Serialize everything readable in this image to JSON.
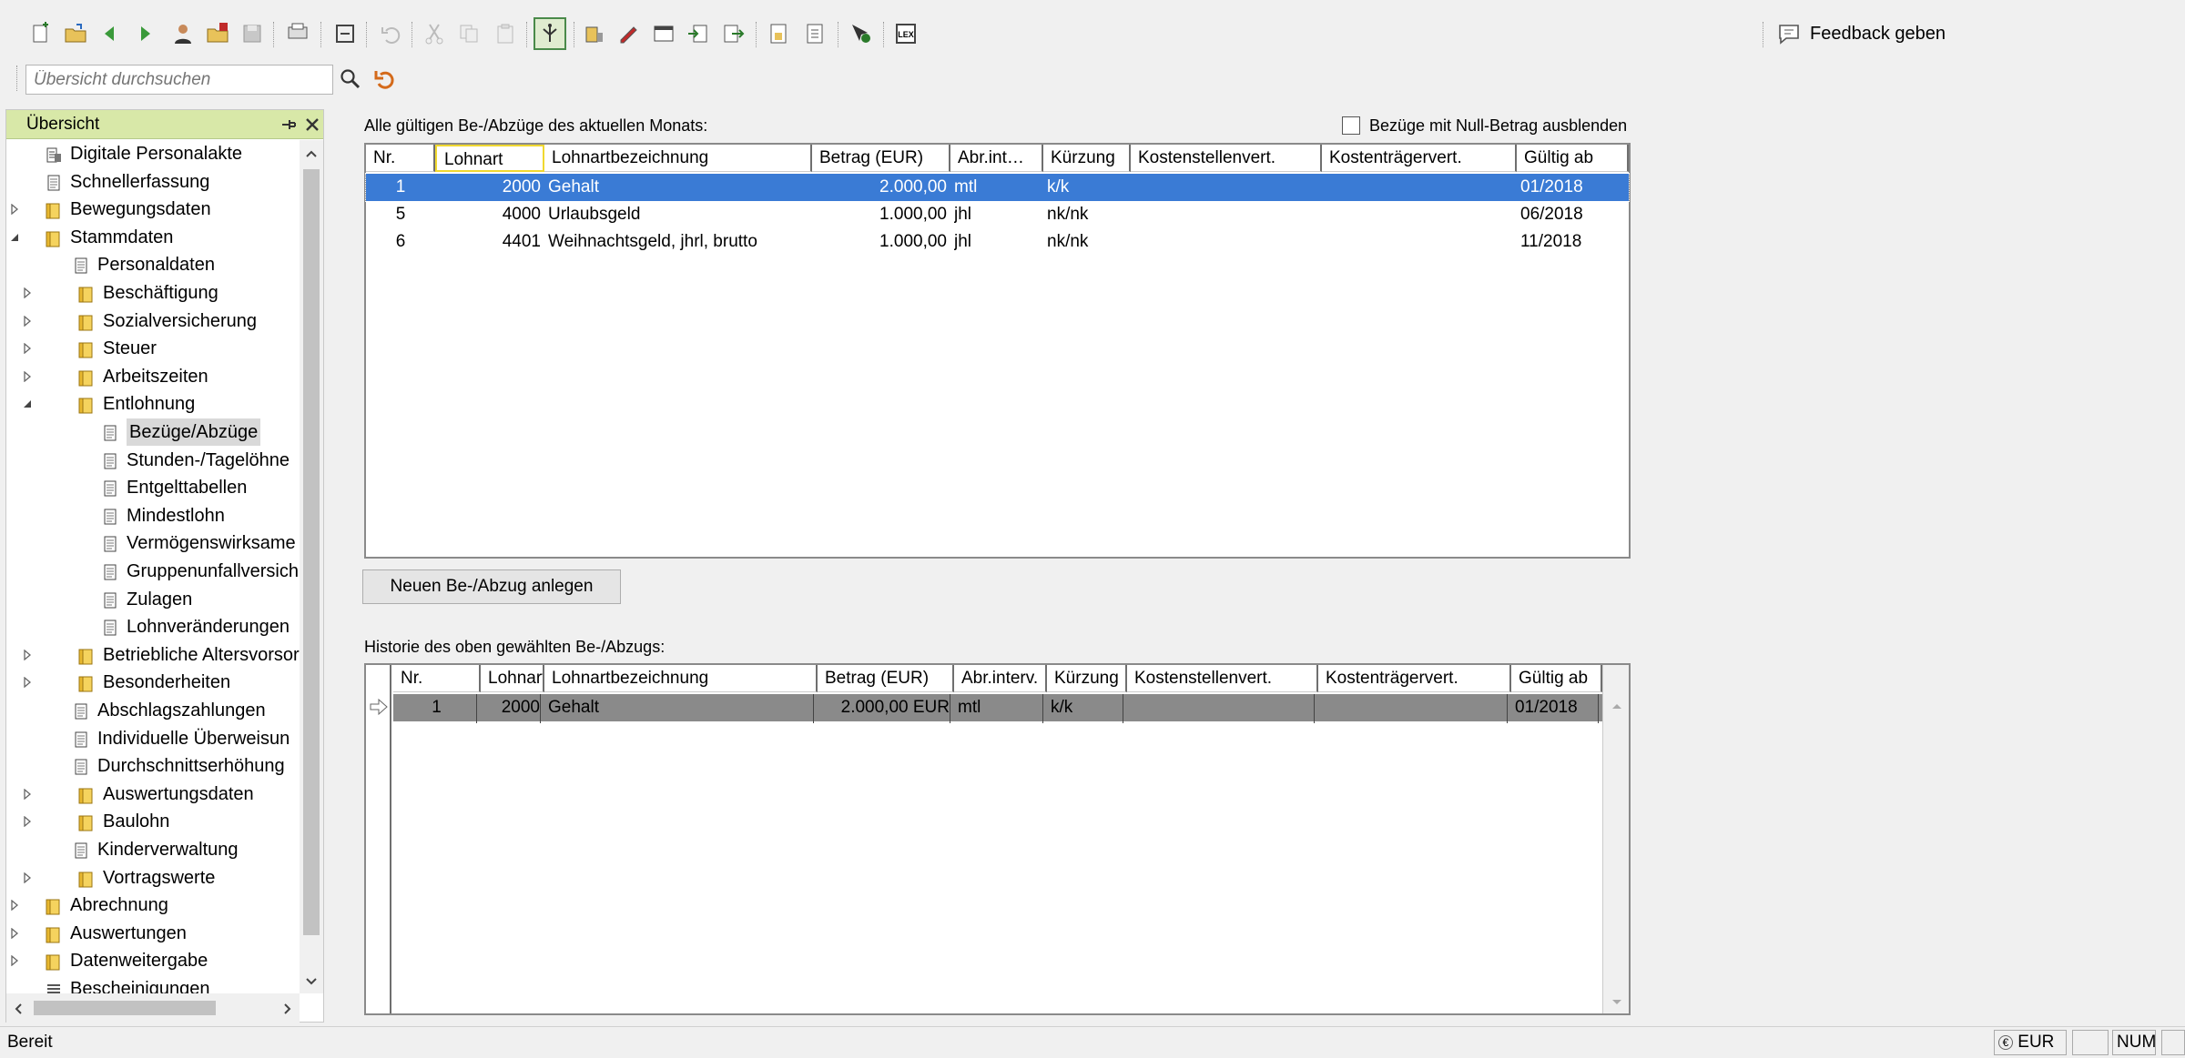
{
  "toolbar": {
    "feedback_label": "Feedback geben"
  },
  "search": {
    "placeholder": "Übersicht durchsuchen"
  },
  "tree": {
    "title": "Übersicht",
    "items": [
      {
        "label": "Digitale Personalakte",
        "level": 1,
        "expander": "",
        "icon": "building"
      },
      {
        "label": "Schnellerfassung",
        "level": 1,
        "expander": "",
        "icon": "doc"
      },
      {
        "label": "Bewegungsdaten",
        "level": 0,
        "expander": "closed",
        "icon": "folder"
      },
      {
        "label": "Stammdaten",
        "level": 0,
        "expander": "open",
        "icon": "folder"
      },
      {
        "label": "Personaldaten",
        "level": 2,
        "expander": "",
        "icon": "doc"
      },
      {
        "label": "Beschäftigung",
        "level": 1,
        "expander": "closed",
        "icon": "folder"
      },
      {
        "label": "Sozialversicherung",
        "level": 1,
        "expander": "closed",
        "icon": "folder"
      },
      {
        "label": "Steuer",
        "level": 1,
        "expander": "closed",
        "icon": "folder"
      },
      {
        "label": "Arbeitszeiten",
        "level": 1,
        "expander": "closed",
        "icon": "folder"
      },
      {
        "label": "Entlohnung",
        "level": 1,
        "expander": "open",
        "icon": "folder"
      },
      {
        "label": "Bezüge/Abzüge",
        "level": 3,
        "expander": "",
        "icon": "doc",
        "selected": true
      },
      {
        "label": "Stunden-/Tagelöhne",
        "level": 3,
        "expander": "",
        "icon": "doc"
      },
      {
        "label": "Entgelttabellen",
        "level": 3,
        "expander": "",
        "icon": "doc"
      },
      {
        "label": "Mindestlohn",
        "level": 3,
        "expander": "",
        "icon": "doc"
      },
      {
        "label": "Vermögenswirksame",
        "level": 3,
        "expander": "",
        "icon": "doc"
      },
      {
        "label": "Gruppenunfallversich",
        "level": 3,
        "expander": "",
        "icon": "doc"
      },
      {
        "label": "Zulagen",
        "level": 3,
        "expander": "",
        "icon": "doc"
      },
      {
        "label": "Lohnveränderungen",
        "level": 3,
        "expander": "",
        "icon": "doc"
      },
      {
        "label": "Betriebliche Altersvorsor",
        "level": 1,
        "expander": "closed",
        "icon": "folder"
      },
      {
        "label": "Besonderheiten",
        "level": 1,
        "expander": "closed",
        "icon": "folder"
      },
      {
        "label": "Abschlagszahlungen",
        "level": 2,
        "expander": "",
        "icon": "doc"
      },
      {
        "label": "Individuelle Überweisun",
        "level": 2,
        "expander": "",
        "icon": "doc"
      },
      {
        "label": "Durchschnittserhöhung",
        "level": 2,
        "expander": "",
        "icon": "doc"
      },
      {
        "label": "Auswertungsdaten",
        "level": 1,
        "expander": "closed",
        "icon": "folder"
      },
      {
        "label": "Baulohn",
        "level": 1,
        "expander": "closed",
        "icon": "folder"
      },
      {
        "label": "Kinderverwaltung",
        "level": 2,
        "expander": "",
        "icon": "doc"
      },
      {
        "label": "Vortragswerte",
        "level": 1,
        "expander": "closed",
        "icon": "folder"
      },
      {
        "label": "Abrechnung",
        "level": 0,
        "expander": "closed",
        "icon": "folder"
      },
      {
        "label": "Auswertungen",
        "level": 0,
        "expander": "closed",
        "icon": "folder"
      },
      {
        "label": "Datenweitergabe",
        "level": 0,
        "expander": "closed",
        "icon": "folder"
      },
      {
        "label": "Bescheinigungen",
        "level": 1,
        "expander": "",
        "icon": "list"
      }
    ]
  },
  "current": {
    "caption": "Alle gültigen Be-/Abzüge des aktuellen Monats:",
    "hide_zero_label": "Bezüge mit Null-Betrag ausblenden",
    "columns": [
      "Nr.",
      "Lohnart",
      "Lohnartbezeichnung",
      "Betrag (EUR)",
      "Abr.int…",
      "Kürzung",
      "Kostenstellenvert.",
      "Kostenträgervert.",
      "Gültig ab"
    ],
    "rows": [
      {
        "nr": "1",
        "lohnart": "2000",
        "bezeichnung": "Gehalt",
        "betrag": "2.000,00",
        "abr": "mtl",
        "kuerzung": "k/k",
        "kst": "",
        "ktr": "",
        "gueltig": "01/2018",
        "selected": true
      },
      {
        "nr": "5",
        "lohnart": "4000",
        "bezeichnung": "Urlaubsgeld",
        "betrag": "1.000,00",
        "abr": "jhl",
        "kuerzung": "nk/nk",
        "kst": "",
        "ktr": "",
        "gueltig": "06/2018"
      },
      {
        "nr": "6",
        "lohnart": "4401",
        "bezeichnung": "Weihnachtsgeld, jhrl, brutto",
        "betrag": "1.000,00",
        "abr": "jhl",
        "kuerzung": "nk/nk",
        "kst": "",
        "ktr": "",
        "gueltig": "11/2018"
      }
    ]
  },
  "create_button_label": "Neuen Be-/Abzug anlegen",
  "history": {
    "caption": "Historie des oben gewählten Be-/Abzugs:",
    "columns": [
      "Nr.",
      "Lohnart",
      "Lohnartbezeichnung",
      "Betrag (EUR)",
      "Abr.interv.",
      "Kürzung",
      "Kostenstellenvert.",
      "Kostenträgervert.",
      "Gültig ab"
    ],
    "rows": [
      {
        "nr": "1",
        "lohnart": "2000",
        "bezeichnung": "Gehalt",
        "betrag": "2.000,00 EUR",
        "abr": "mtl",
        "kuerzung": "k/k",
        "kst": "",
        "ktr": "",
        "gueltig": "01/2018"
      }
    ]
  },
  "status": {
    "text": "Bereit",
    "currency": "EUR",
    "num": "NUM"
  },
  "colors": {
    "selection": "#3a7bd5",
    "tree_header": "#d8e8a8",
    "history_row": "#8a8a8a"
  }
}
